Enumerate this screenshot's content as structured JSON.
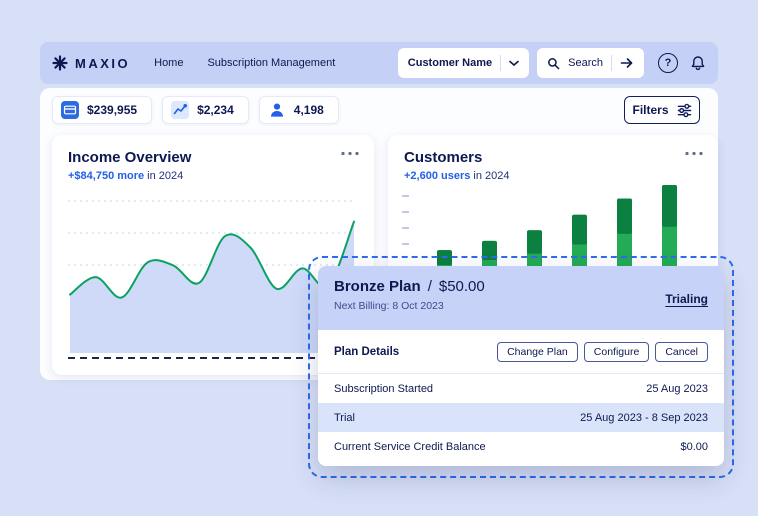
{
  "nav": {
    "brand": "MAXIO",
    "home": "Home",
    "subscription_mgmt": "Subscription Management",
    "customer_dropdown": "Customer Name",
    "search_label": "Search",
    "help_glyph": "?"
  },
  "icons": {
    "brand": "asterisk-logo",
    "dropdown": "chevron-down",
    "search": "magnifier",
    "search_go": "arrow-right",
    "help": "question-circle",
    "notifications": "bell",
    "stat1": "credit-card",
    "stat2": "trend-line",
    "stat3": "user",
    "filters": "sliders",
    "card_menu": "ellipsis-dots"
  },
  "stats": [
    {
      "icon": "credit-card",
      "value": "$239,955"
    },
    {
      "icon": "trend-line",
      "value": "$2,234"
    },
    {
      "icon": "user",
      "value": "4,198"
    }
  ],
  "filters_label": "Filters",
  "income_card": {
    "title": "Income Overview",
    "highlight": "+$84,750 more",
    "suffix": "in 2024"
  },
  "customers_card": {
    "title": "Customers",
    "highlight": "+2,600 users",
    "suffix": "in 2024"
  },
  "modal": {
    "plan_name": "Bronze Plan",
    "separator": "/",
    "price": "$50.00",
    "next_billing": "Next Billing: 8 Oct 2023",
    "status": "Trialing",
    "section_title": "Plan Details",
    "buttons": [
      "Change Plan",
      "Configure",
      "Cancel"
    ],
    "rows": [
      {
        "label": "Subscription Started",
        "value": "25 Aug 2023"
      },
      {
        "label": "Trial",
        "value": "25 Aug 2023 - 8 Sep 2023"
      },
      {
        "label": "Current Service Credit Balance",
        "value": "$0.00"
      }
    ]
  },
  "colors": {
    "page_bg": "#d8e0f7",
    "nav_bg": "#c4d0f6",
    "accent_navy": "#0d1950",
    "accent_blue": "#2360e7",
    "modal_header_bg": "#c6d2f7",
    "trial_row_bg": "#d9e4fb",
    "dashed_border": "#2e6bee",
    "line_green": "#0aa263",
    "bar_green": "#23ab55",
    "bar_green_dark": "#0b8040",
    "area_fill": "#c9d6f7"
  },
  "chart_data": [
    {
      "type": "area",
      "title": "Income Overview",
      "annotation": "+$84,750 more in 2024",
      "values": [
        40,
        52,
        38,
        62,
        60,
        48,
        80,
        72,
        44,
        58,
        46,
        90
      ],
      "value_scale": "relative-percent-of-max",
      "line_color": "#0aa263",
      "fill_color": "#c9d6f7",
      "baseline": "dashed-dark",
      "gridlines": 3,
      "legend_position": "none"
    },
    {
      "type": "bar",
      "title": "Customers",
      "annotation": "+2,600 users in 2024",
      "stacked": true,
      "series": [
        {
          "name": "existing-users",
          "values": [
            1470,
            1540,
            1630,
            1760,
            1910,
            2010
          ],
          "color": "#23ab55"
        },
        {
          "name": "new-users",
          "values": [
            210,
            270,
            330,
            420,
            500,
            590
          ],
          "color": "#0b8040"
        }
      ],
      "y_max": 2600,
      "x_labels_visible": false,
      "legend_position": "none"
    }
  ]
}
